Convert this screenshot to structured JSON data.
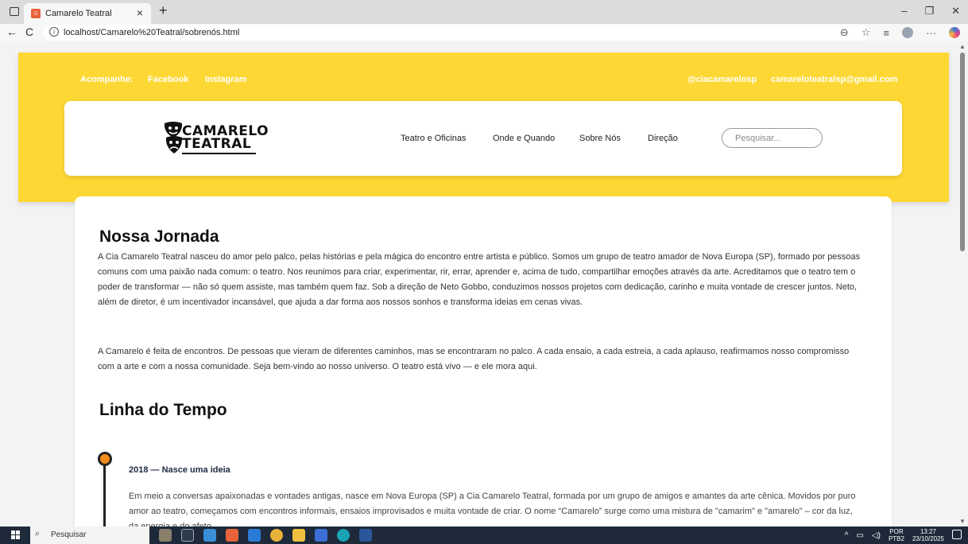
{
  "browser": {
    "tab_title": "Camarelo Teatral",
    "tab_close": "×",
    "new_tab": "+",
    "url": "localhost/Camarelo%20Teatral/sobrenós.html",
    "win_min": "–",
    "win_max": "❐",
    "win_close": "✕",
    "back": "←",
    "reload": "C"
  },
  "header": {
    "follow_label": "Acompanhe:",
    "facebook": "Facebook",
    "instagram": "Instagram",
    "handle": "@ciacamarelosp",
    "email": "camareloteatralsp@gmail.com",
    "logo_line1": "CAMARELO",
    "logo_line2": "TEATRAL",
    "nav": [
      "Teatro e Oficinas",
      "Onde e Quando",
      "Sobre Nós",
      "Direção"
    ],
    "search_placeholder": "Pesquisar..."
  },
  "main": {
    "jornada_title": "Nossa Jornada",
    "para1": "A Cia Camarelo Teatral nasceu do amor pelo palco, pelas histórias e pela mágica do encontro entre artista e público. Somos um grupo de teatro amador de Nova Europa (SP), formado por pessoas comuns com uma paixão nada comum: o teatro. Nos reunimos para criar, experimentar, rir, errar, aprender e, acima de tudo, compartilhar emoções através da arte. Acreditamos que o teatro tem o poder de transformar — não só quem assiste, mas também quem faz. Sob a direção de Neto Gobbo, conduzimos nossos projetos com dedicação, carinho e muita vontade de crescer juntos. Neto, além de diretor, é um incentivador incansável, que ajuda a dar forma aos nossos sonhos e transforma ideias em cenas vivas.",
    "para2": "A Camarelo é feita de encontros. De pessoas que vieram de diferentes caminhos, mas se encontraram no palco. A cada ensaio, a cada estreia, a cada aplauso, reafirmamos nosso compromisso com a arte e com a nossa comunidade. Seja bem-vindo ao nosso universo. O teatro está vivo — e ele mora aqui.",
    "timeline_title": "Linha do Tempo",
    "timeline": [
      {
        "title": "2018 — Nasce uma ideia",
        "text": "Em meio a conversas apaixonadas e vontades antigas, nasce em Nova Europa (SP) a Cia Camarelo Teatral, formada por um grupo de amigos e amantes da arte cênica. Movidos por puro amor ao teatro, começamos com encontros informais, ensaios improvisados e muita vontade de criar. O nome “Camarelo” surge como uma mistura de \"camarim\" e \"amarelo\" – cor da luz, da energia e do afeto."
      }
    ]
  },
  "taskbar": {
    "search": "Pesquisar",
    "lang_top": "POR",
    "lang_bottom": "PTB2",
    "time": "13:27",
    "date": "23/10/2025"
  },
  "colors": {
    "header_yellow": "#fdd835",
    "timeline_dot": "#f28c1a",
    "taskbar": "#1e2a3a"
  }
}
